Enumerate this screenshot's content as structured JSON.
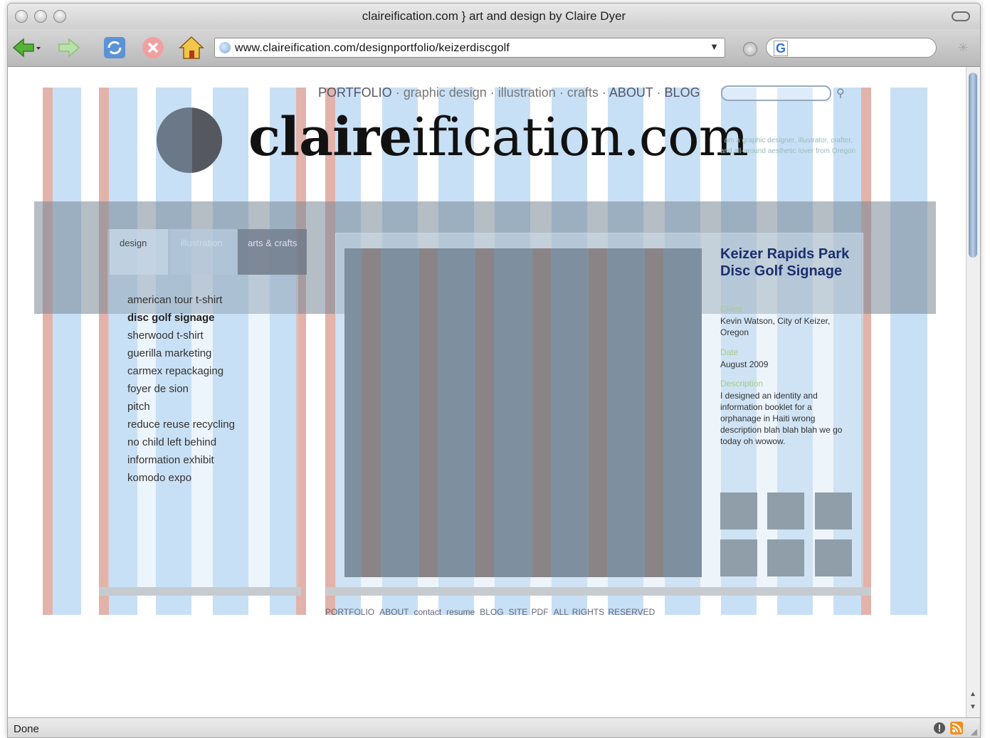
{
  "browser": {
    "window_title": "claireification.com } art and design by Claire Dyer",
    "url": "www.claireification.com/designportfolio/keizerdiscgolf",
    "search_engine_badge": "G",
    "status": "Done"
  },
  "site": {
    "nav": {
      "portfolio": "PORTFOLIO",
      "sep1": " · ",
      "graphic_design": "graphic design",
      "sep2": " · ",
      "illustration": "illustration",
      "sep3": " · ",
      "crafts": "crafts",
      "sep4": " · ",
      "about": "ABOUT",
      "sep5": " · ",
      "blog": "BLOG"
    },
    "logo": {
      "bold_part": "claire",
      "regular_part": "ification.com"
    },
    "tagline": "I am a graphic designer, illustrator, crafter, and all-around aesthetic lover from Oregon",
    "tabs": [
      {
        "label": "design"
      },
      {
        "label": "illustration"
      },
      {
        "label": "arts & crafts"
      }
    ],
    "menu": [
      "american tour t-shirt",
      "disc golf signage",
      "sherwood t-shirt",
      "guerilla marketing",
      "carmex repackaging",
      "foyer de sion",
      "pitch",
      "reduce reuse recycling",
      "no child left behind",
      "information exhibit",
      "komodo expo"
    ],
    "project": {
      "title": "Keizer Rapids Park Disc Golf Signage",
      "client_label": "Client",
      "client_value": "Kevin Watson, City of Keizer, Oregon",
      "date_label": "Date",
      "date_value": "August 2009",
      "description_label": "Description",
      "description_value": "I designed an identity and information booklet for a orphanage in Haiti wrong description blah blah blah we go today oh wowow."
    },
    "footer": {
      "portfolio": "PORTFOLIO",
      "about": "ABOUT",
      "contact": "contact",
      "resume": "resume",
      "blog": "BLOG",
      "site_pdf": "SITE PDF",
      "rights": "ALL RIGHTS RESERVED"
    }
  }
}
